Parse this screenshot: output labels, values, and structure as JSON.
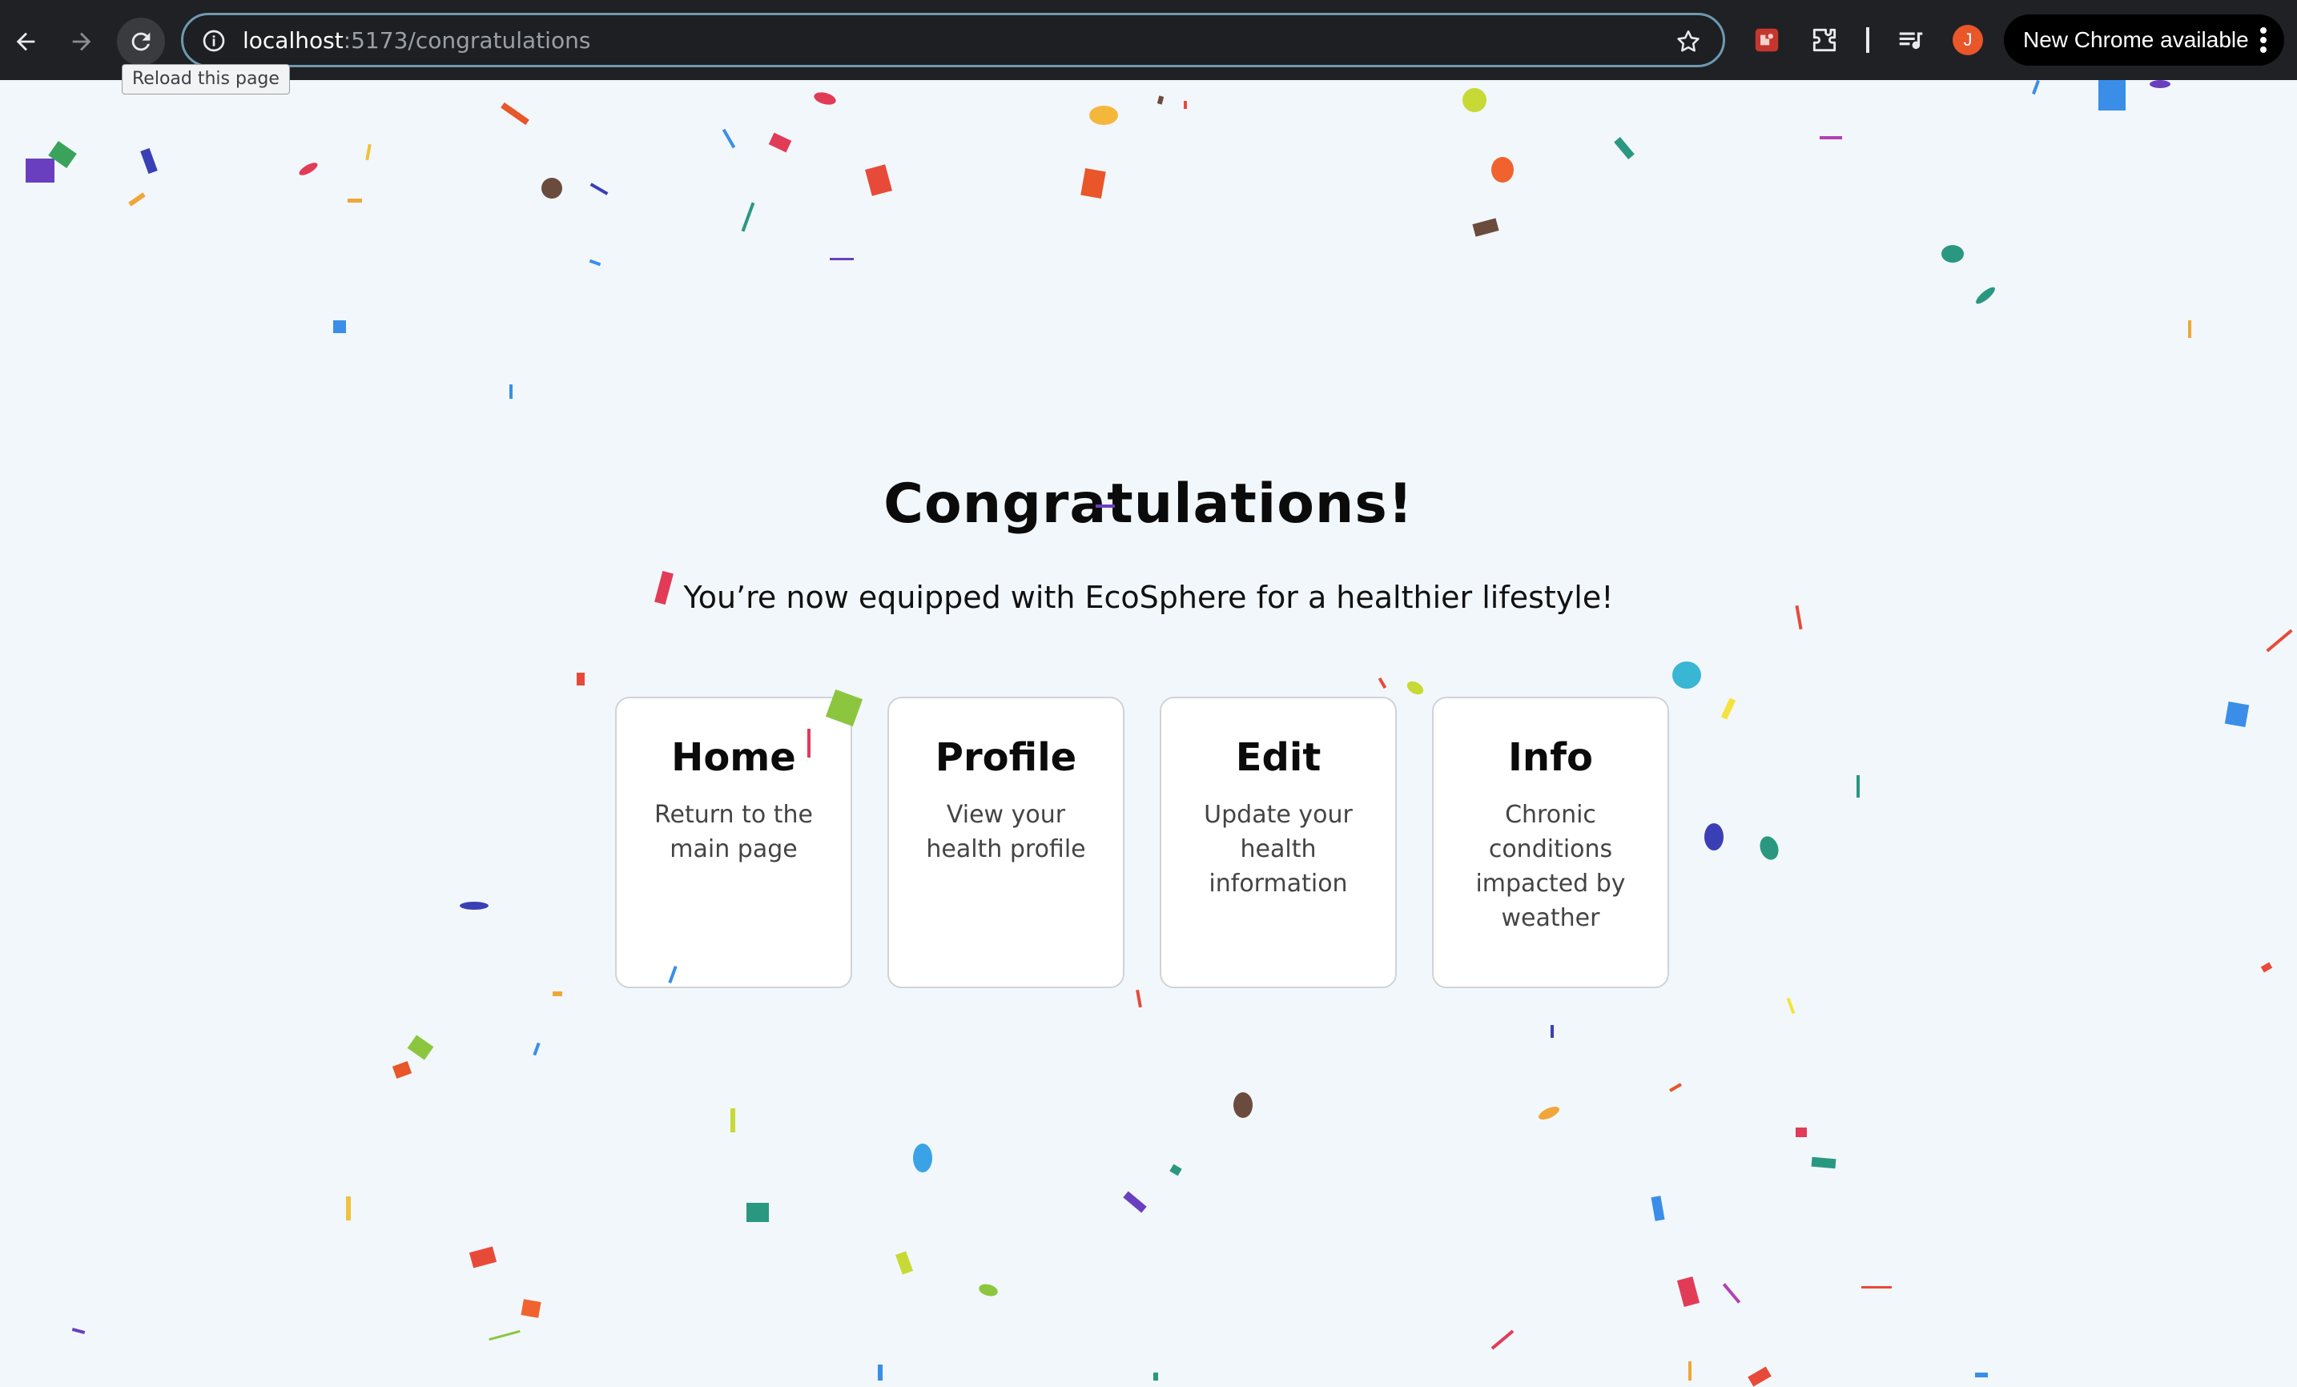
{
  "browser": {
    "url_host": "localhost",
    "url_path": ":5173/congratulations",
    "tooltip": "Reload this page",
    "profile_initial": "J",
    "update_label": "New Chrome available"
  },
  "page": {
    "title": "Congratulations!",
    "subtitle": "You’re now equipped with EcoSphere for a healthier lifestyle!",
    "cards": [
      {
        "title": "Home",
        "description": "Return to the main page"
      },
      {
        "title": "Profile",
        "description": "View your health profile"
      },
      {
        "title": "Edit",
        "description": "Update your health information"
      },
      {
        "title": "Info",
        "description": "Chronic conditions impacted by weather"
      }
    ]
  }
}
